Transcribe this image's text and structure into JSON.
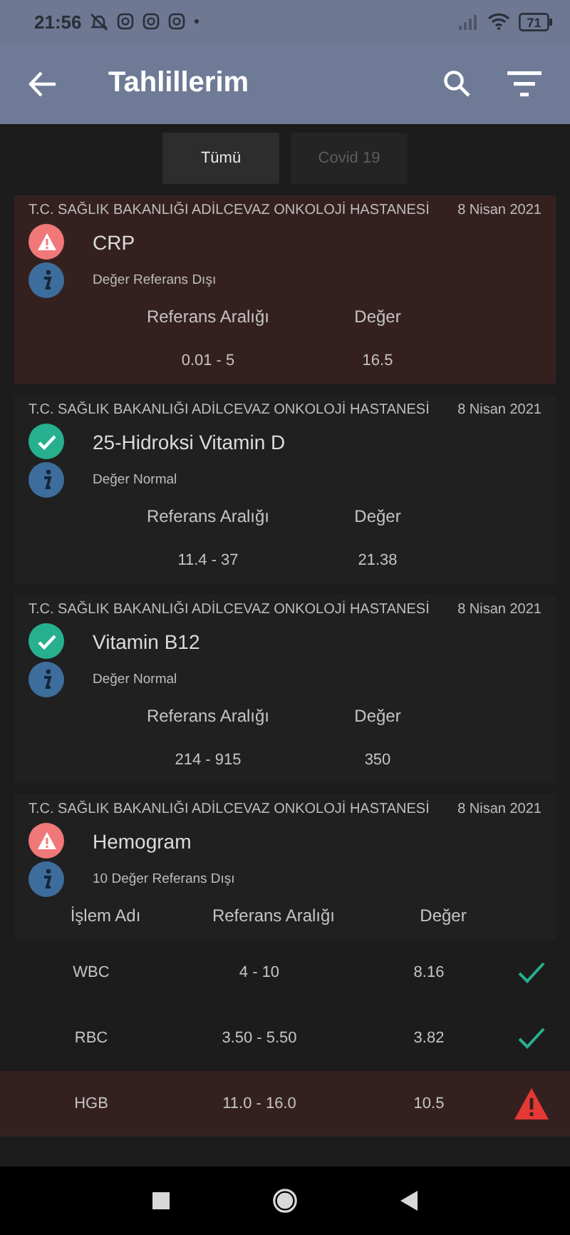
{
  "status_bar": {
    "time": "21:56",
    "battery": "71"
  },
  "app_bar": {
    "title": "Tahlillerim"
  },
  "tabs": [
    {
      "label": "Tümü",
      "selected": true
    },
    {
      "label": "Covid 19",
      "selected": false
    }
  ],
  "tests": [
    {
      "kind": "abnormal",
      "hospital": "T.C. SAĞLIK BAKANLIĞI ADİLCEVAZ ONKOLOJİ HASTANESİ",
      "date": "8 Nisan 2021",
      "name": "CRP",
      "status": "Değer Referans Dışı",
      "columns": [
        "Referans Aralığı",
        "Değer"
      ],
      "reference": "0.01 - 5",
      "value": "16.5"
    },
    {
      "kind": "normal",
      "hospital": "T.C. SAĞLIK BAKANLIĞI ADİLCEVAZ ONKOLOJİ HASTANESİ",
      "date": "8 Nisan 2021",
      "name": "25-Hidroksi Vitamin D",
      "status": "Değer Normal",
      "columns": [
        "Referans Aralığı",
        "Değer"
      ],
      "reference": "11.4 - 37",
      "value": "21.38"
    },
    {
      "kind": "normal",
      "hospital": "T.C. SAĞLIK BAKANLIĞI ADİLCEVAZ ONKOLOJİ HASTANESİ",
      "date": "8 Nisan 2021",
      "name": "Vitamin B12",
      "status": "Değer Normal",
      "columns": [
        "Referans Aralığı",
        "Değer"
      ],
      "reference": "214 - 915",
      "value": "350"
    },
    {
      "kind": "panel",
      "abnormal": true,
      "hospital": "T.C. SAĞLIK BAKANLIĞI ADİLCEVAZ ONKOLOJİ HASTANESİ",
      "date": "8 Nisan 2021",
      "name": "Hemogram",
      "status": "10 Değer Referans Dışı",
      "columns": [
        "İşlem Adı",
        "Referans Aralığı",
        "Değer"
      ],
      "rows": [
        {
          "name": "WBC",
          "reference": "4 - 10",
          "value": "8.16",
          "abnormal": false
        },
        {
          "name": "RBC",
          "reference": "3.50 - 5.50",
          "value": "3.82",
          "abnormal": false
        },
        {
          "name": "HGB",
          "reference": "11.0 - 16.0",
          "value": "10.5",
          "abnormal": true
        }
      ]
    }
  ]
}
